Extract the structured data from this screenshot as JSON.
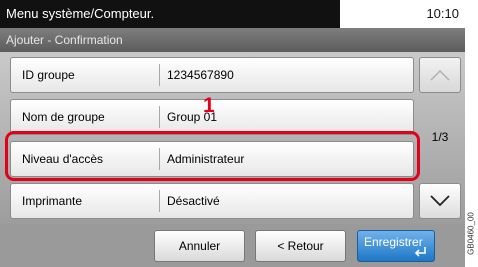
{
  "header": {
    "title": "Menu système/Compteur.",
    "time": "10:10"
  },
  "subheader": {
    "title": "Ajouter - Confirmation"
  },
  "rows": [
    {
      "label": "ID groupe",
      "value": "1234567890"
    },
    {
      "label": "Nom de groupe",
      "value": "Group 01"
    },
    {
      "label": "Niveau d'accès",
      "value": "Administrateur"
    },
    {
      "label": "Imprimante",
      "value": "Désactivé"
    }
  ],
  "pagination": {
    "indicator": "1/3"
  },
  "callout": {
    "number": "1"
  },
  "buttons": {
    "cancel": "Annuler",
    "back": "< Retour",
    "save": "Enregistrer"
  },
  "figure_code": "GB0460_00",
  "icons": {
    "up": "chevron-up-icon",
    "down": "chevron-down-icon",
    "enter": "enter-icon"
  },
  "colors": {
    "highlight": "#e2001a",
    "primary": "#1f77c6"
  }
}
